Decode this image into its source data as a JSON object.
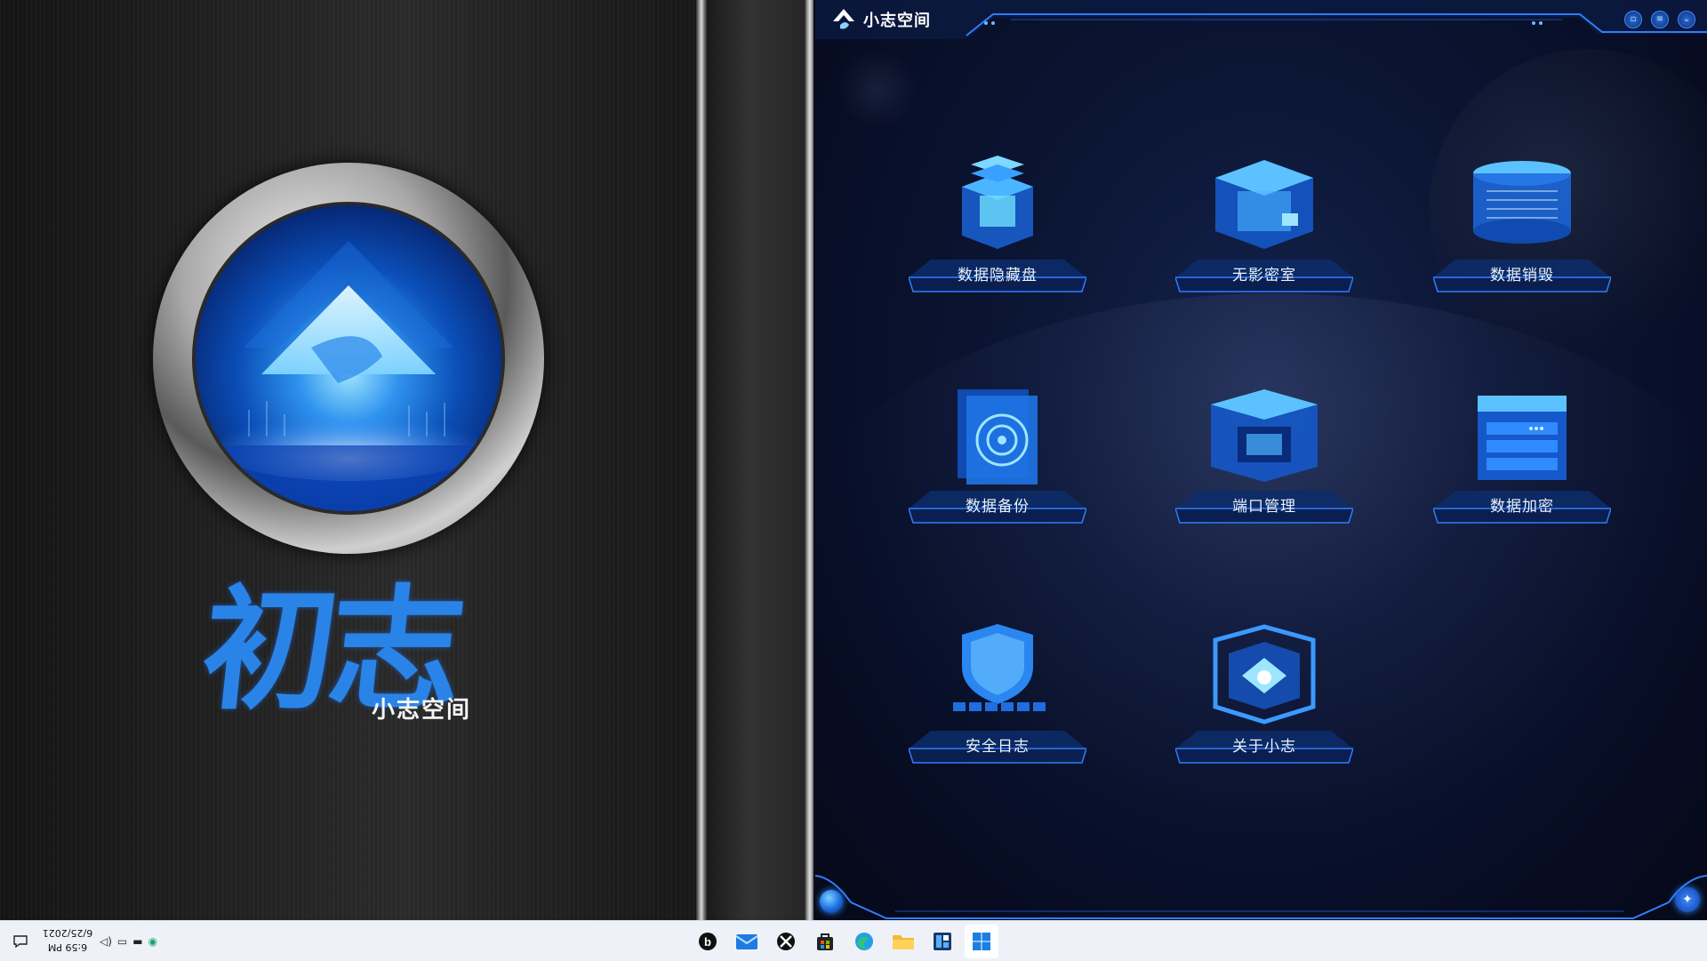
{
  "desktop": {
    "brand_big": "初志",
    "brand_small": "小志空间"
  },
  "app": {
    "title": "小志空间",
    "window_buttons": [
      "minimize-button",
      "menu-button",
      "collapse-button"
    ],
    "tiles": [
      {
        "id": "data-hide-disk",
        "label": "数据隐藏盘",
        "icon": "stacked-box-icon"
      },
      {
        "id": "shadowless-room",
        "label": "无影密室",
        "icon": "vault-cube-icon"
      },
      {
        "id": "data-destroy",
        "label": "数据销毁",
        "icon": "shredder-icon"
      },
      {
        "id": "data-backup",
        "label": "数据备份",
        "icon": "backup-disk-icon"
      },
      {
        "id": "port-management",
        "label": "端口管理",
        "icon": "port-cube-icon"
      },
      {
        "id": "data-encryption",
        "label": "数据加密",
        "icon": "encrypted-server-icon"
      },
      {
        "id": "security-log",
        "label": "安全日志",
        "icon": "shield-log-icon"
      },
      {
        "id": "about",
        "label": "关于小志",
        "icon": "about-cube-icon"
      }
    ],
    "accent": "#2a8bff"
  },
  "taskbar": {
    "clock_time": "6:59 PM",
    "clock_date": "6/25/2021",
    "apps": [
      "start-icon",
      "widgets-icon",
      "file-explorer-icon",
      "edge-icon",
      "store-icon",
      "xbox-icon",
      "mail-icon",
      "bing-icon"
    ],
    "tray": [
      "notification-icon",
      "volume-icon",
      "network-icon",
      "battery-icon",
      "edge-tray-icon"
    ]
  }
}
